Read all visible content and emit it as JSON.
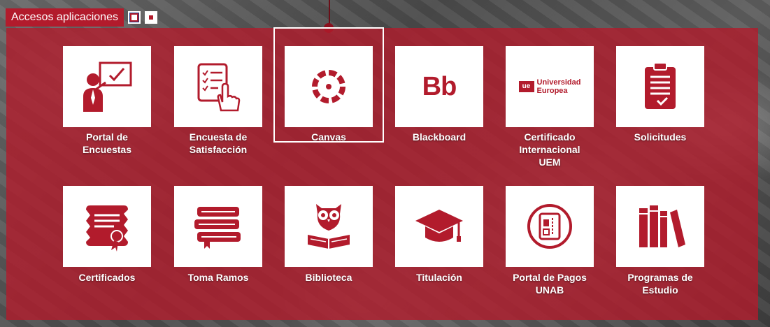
{
  "header": {
    "title": "Accesos aplicaciones",
    "buttons": [
      {
        "icon": "square-outline-icon"
      },
      {
        "icon": "square-filled-icon"
      }
    ]
  },
  "colors": {
    "brand": "#b21b2c",
    "tile_bg": "#ffffff",
    "label": "#ffffff"
  },
  "apps": [
    {
      "label_lines": [
        "Portal de",
        "Encuestas"
      ],
      "icon": "presenter-icon"
    },
    {
      "label_lines": [
        "Encuesta de",
        "Satisfacción"
      ],
      "icon": "survey-checklist-icon"
    },
    {
      "label_lines": [
        "Canvas"
      ],
      "icon": "canvas-logo-icon"
    },
    {
      "label_lines": [
        "Blackboard"
      ],
      "icon": "blackboard-logo-icon",
      "logo_text": "Bb"
    },
    {
      "label_lines": [
        "Certificado",
        "Internacional",
        "UEM"
      ],
      "icon": "universidad-europea-logo-icon",
      "logo_lines": [
        "Universidad",
        "Europea"
      ]
    },
    {
      "label_lines": [
        "Solicitudes"
      ],
      "icon": "clipboard-check-icon"
    },
    {
      "label_lines": [
        "Certificados"
      ],
      "icon": "certificate-icon"
    },
    {
      "label_lines": [
        "Toma Ramos"
      ],
      "icon": "books-stack-icon"
    },
    {
      "label_lines": [
        "Biblioteca"
      ],
      "icon": "owl-book-icon"
    },
    {
      "label_lines": [
        "Titulación"
      ],
      "icon": "graduation-cap-icon"
    },
    {
      "label_lines": [
        "Portal de Pagos",
        "UNAB"
      ],
      "icon": "payment-card-icon"
    },
    {
      "label_lines": [
        "Programas de",
        "Estudio"
      ],
      "icon": "bookshelf-icon"
    }
  ]
}
